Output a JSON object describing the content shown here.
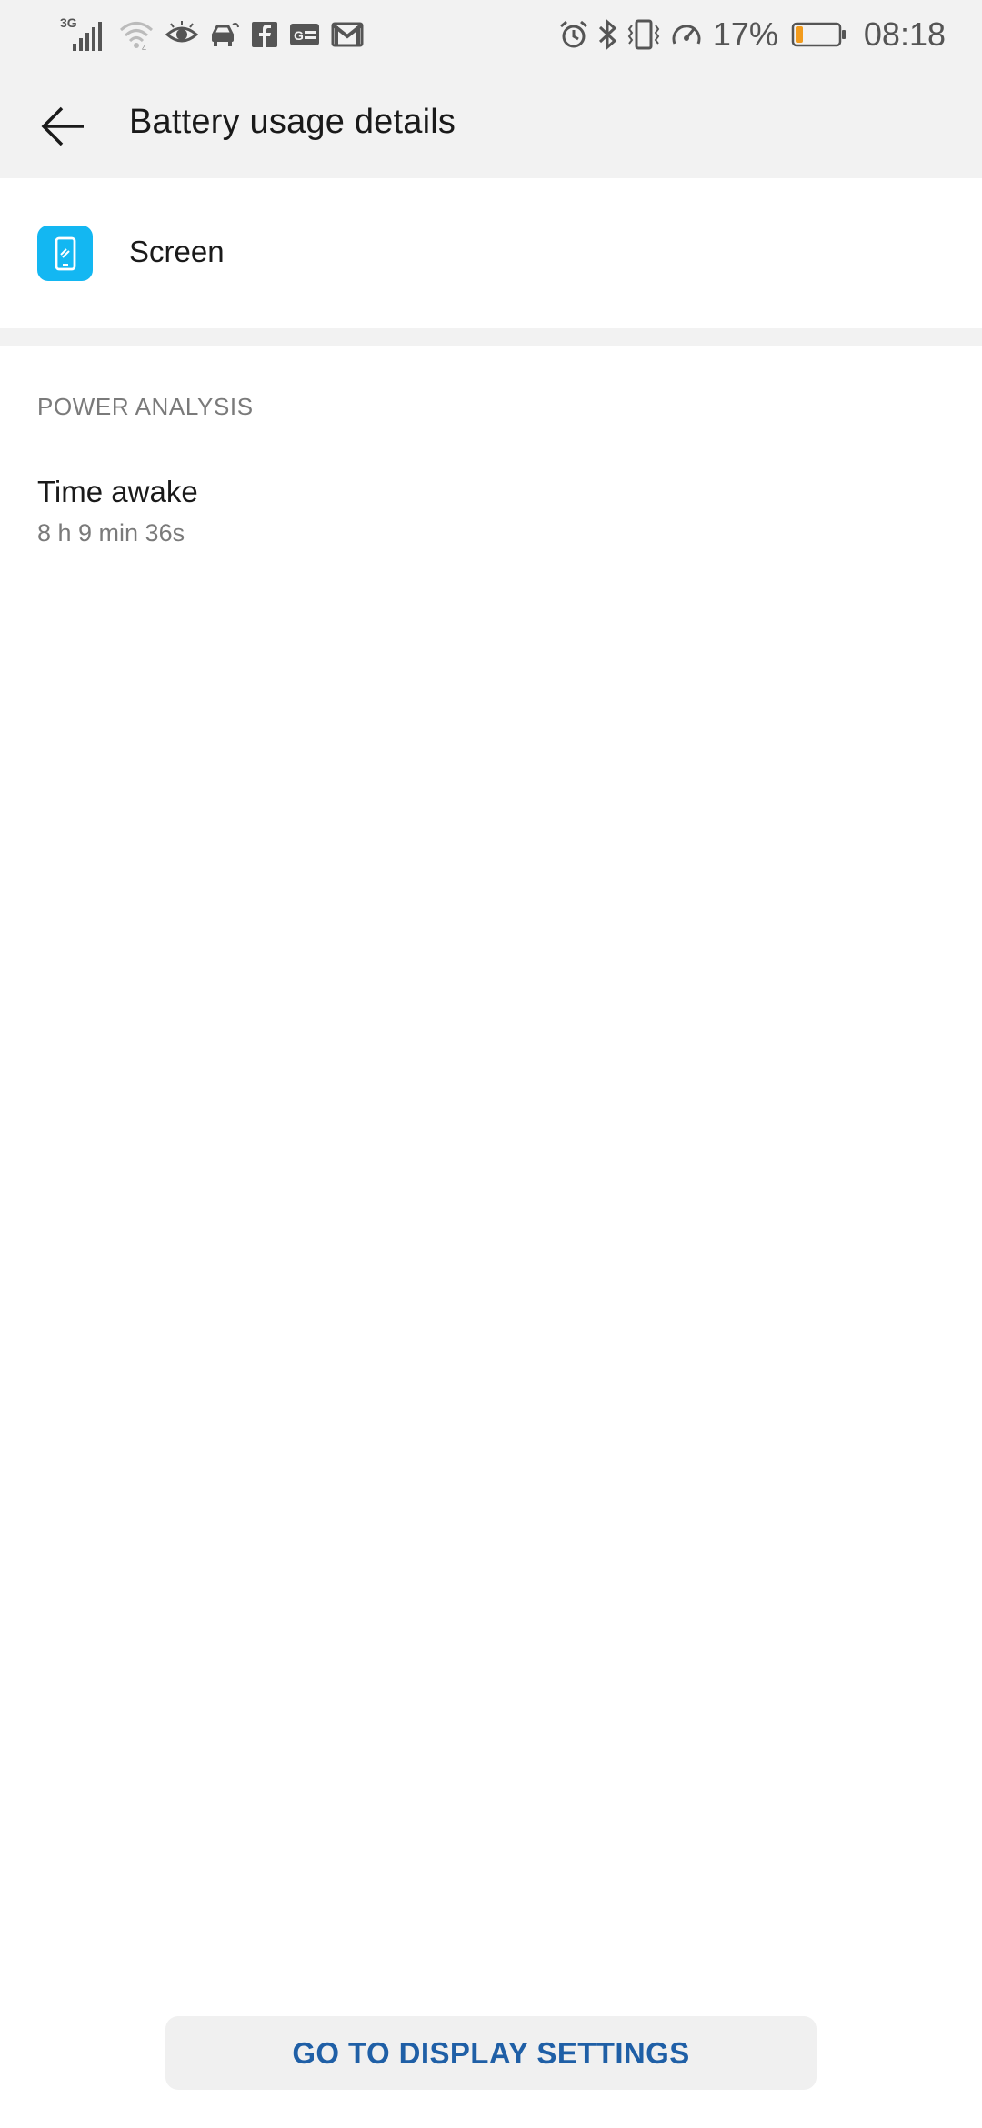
{
  "status_bar": {
    "network_type": "3G",
    "battery_percent": "17%",
    "battery_level": 0.17,
    "time": "08:18",
    "icons_left": [
      "signal-3g-icon",
      "wifi-icon",
      "eye-icon",
      "car-icon",
      "facebook-icon",
      "news-icon",
      "gmail-icon"
    ],
    "icons_right": [
      "alarm-icon",
      "bluetooth-icon",
      "vibrate-icon",
      "speedometer-icon",
      "battery-icon"
    ]
  },
  "header": {
    "title": "Battery usage details",
    "back_icon": "arrow-left-icon"
  },
  "app": {
    "name": "Screen",
    "icon": "screen-icon",
    "icon_color": "#13b7f2"
  },
  "power_analysis": {
    "header": "POWER ANALYSIS",
    "items": [
      {
        "label": "Time awake",
        "value": "8 h 9 min 36s"
      }
    ]
  },
  "actions": {
    "display_settings_label": "GO TO DISPLAY SETTINGS"
  },
  "colors": {
    "accent": "#1f5fa6",
    "battery_low": "#f29b1d"
  }
}
